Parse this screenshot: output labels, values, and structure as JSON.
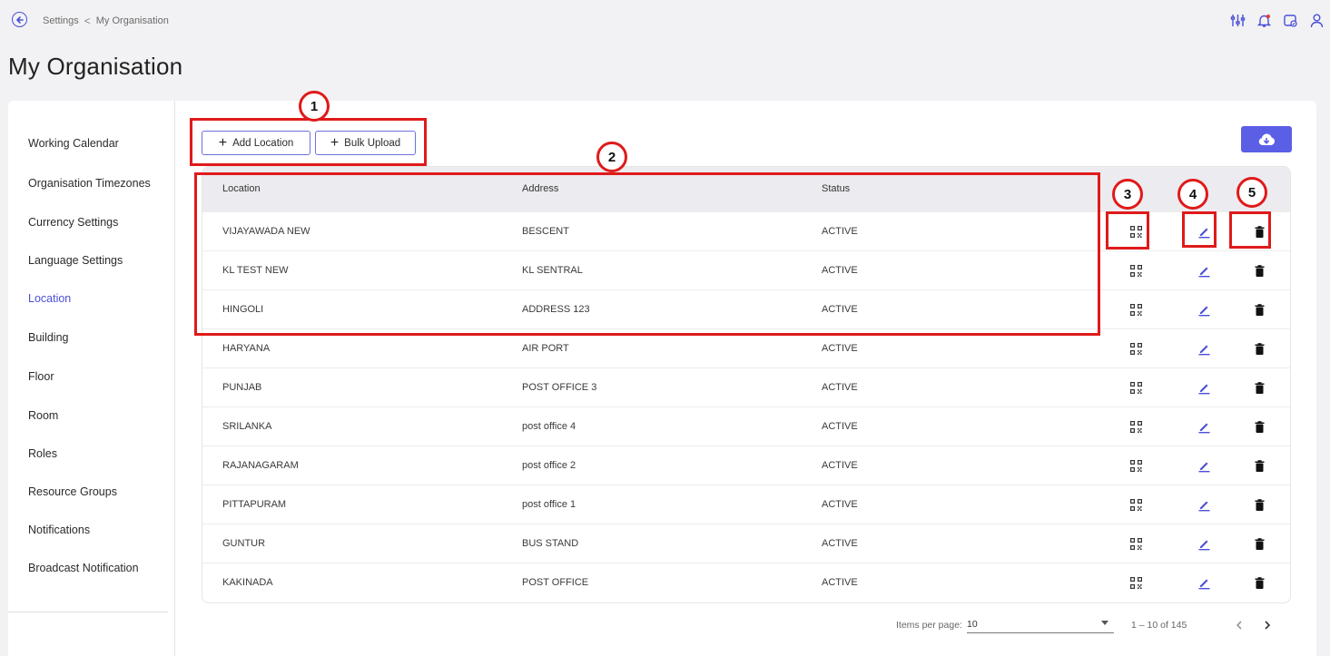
{
  "breadcrumb": {
    "parent": "Settings",
    "separator": "<",
    "current": "My Organisation"
  },
  "page": {
    "title": "My Organisation"
  },
  "top_icons": [
    "tune-sliders-icon",
    "notification-bell-icon",
    "calendar-check-icon",
    "user-icon"
  ],
  "sidebar": {
    "items": [
      {
        "label": "Working Calendar",
        "active": false
      },
      {
        "label": "Organisation Timezones",
        "active": false
      },
      {
        "label": "Currency Settings",
        "active": false
      },
      {
        "label": "Language Settings",
        "active": false
      },
      {
        "label": "Location",
        "active": true
      },
      {
        "label": "Building",
        "active": false
      },
      {
        "label": "Floor",
        "active": false
      },
      {
        "label": "Room",
        "active": false
      },
      {
        "label": "Roles",
        "active": false
      },
      {
        "label": "Resource Groups",
        "active": false
      },
      {
        "label": "Notifications",
        "active": false
      },
      {
        "label": "Broadcast Notification",
        "active": false
      }
    ]
  },
  "toolbar": {
    "add_location_label": "Add Location",
    "bulk_upload_label": "Bulk Upload",
    "download_icon": "cloud-download-icon"
  },
  "table": {
    "headers": [
      "Location",
      "Address",
      "Status"
    ],
    "rows": [
      {
        "location": "VIJAYAWADA NEW",
        "address": "BESCENT",
        "status": "ACTIVE"
      },
      {
        "location": "KL TEST NEW",
        "address": "KL SENTRAL",
        "status": "ACTIVE"
      },
      {
        "location": "HINGOLI",
        "address": "ADDRESS 123",
        "status": "ACTIVE"
      },
      {
        "location": "HARYANA",
        "address": "AIR PORT",
        "status": "ACTIVE"
      },
      {
        "location": "PUNJAB",
        "address": "POST OFFICE 3",
        "status": "ACTIVE"
      },
      {
        "location": "SRILANKA",
        "address": "post office 4",
        "status": "ACTIVE"
      },
      {
        "location": "RAJANAGARAM",
        "address": "post office 2",
        "status": "ACTIVE"
      },
      {
        "location": "PITTAPURAM",
        "address": "post office 1",
        "status": "ACTIVE"
      },
      {
        "location": "GUNTUR",
        "address": "BUS STAND",
        "status": "ACTIVE"
      },
      {
        "location": "KAKINADA",
        "address": "POST OFFICE",
        "status": "ACTIVE"
      }
    ],
    "row_actions": [
      "qr-code-icon",
      "edit-pencil-icon",
      "delete-trash-icon"
    ]
  },
  "pagination": {
    "items_per_page_label": "Items per page:",
    "items_per_page": "10",
    "range": "1 – 10 of 145"
  },
  "annotations": [
    "1",
    "2",
    "3",
    "4",
    "5"
  ],
  "colors": {
    "accent": "#4b4fd6",
    "button_fill": "#5b5fe6",
    "annotation": "#e01a1a",
    "header_bg": "#ececf0"
  }
}
